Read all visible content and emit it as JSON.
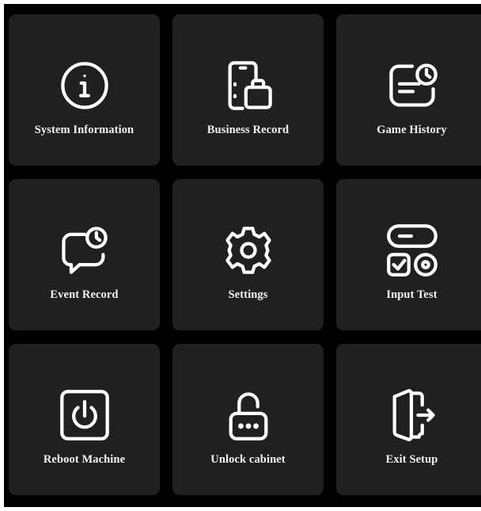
{
  "menu": {
    "tiles": [
      {
        "label": "System Information",
        "icon": "info-circle-icon"
      },
      {
        "label": "Business Record",
        "icon": "phone-briefcase-icon"
      },
      {
        "label": "Game History",
        "icon": "document-clock-icon"
      },
      {
        "label": "Event Record",
        "icon": "chat-clock-icon"
      },
      {
        "label": "Settings",
        "icon": "gear-icon"
      },
      {
        "label": "Input Test",
        "icon": "toggle-controls-icon"
      },
      {
        "label": "Reboot Machine",
        "icon": "power-icon"
      },
      {
        "label": "Unlock cabinet",
        "icon": "unlocked-padlock-icon"
      },
      {
        "label": "Exit Setup",
        "icon": "exit-door-icon"
      }
    ]
  },
  "colors": {
    "page_background": "#ffffff",
    "panel_background": "#000000",
    "tile_background": "#202020",
    "foreground": "#ffffff"
  }
}
